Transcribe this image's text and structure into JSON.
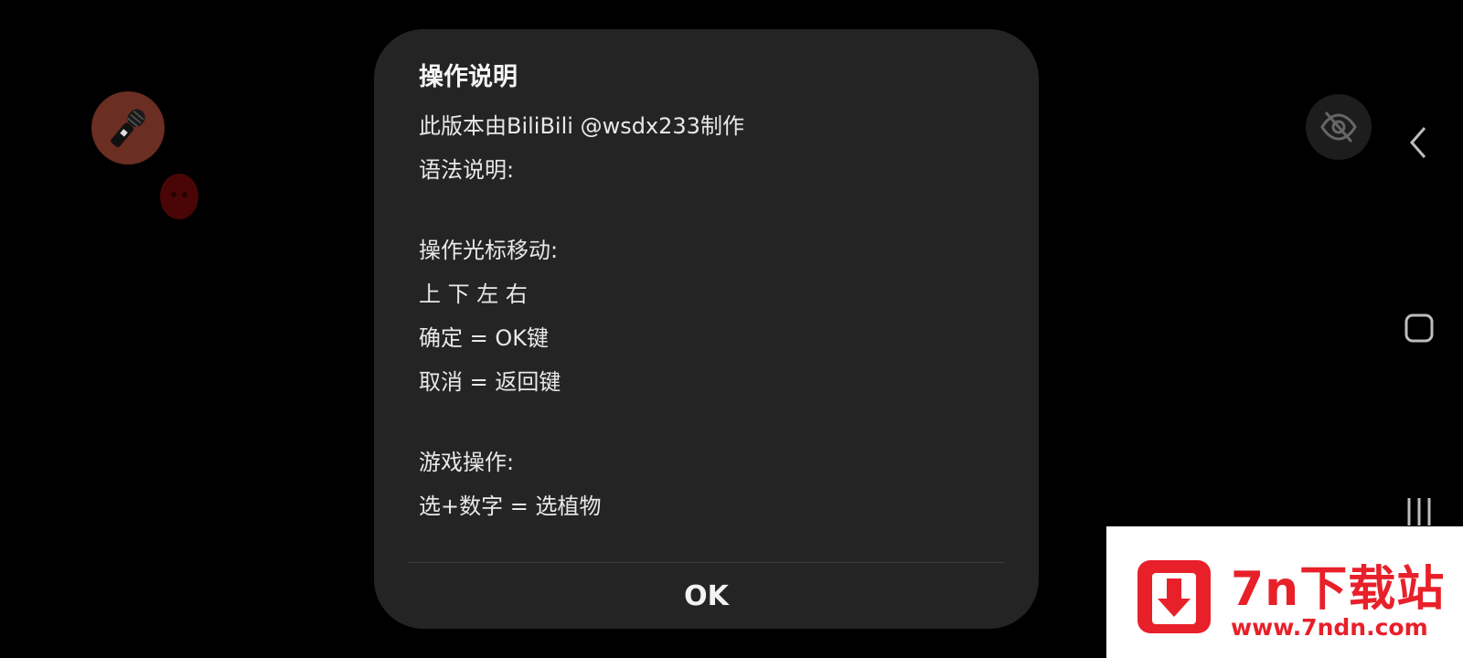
{
  "dialog": {
    "title": "操作说明",
    "lines": [
      "此版本由BiliBili @wsdx233制作",
      "语法说明:",
      "",
      "操作光标移动:",
      "上 下 左 右",
      "确定 = OK键",
      "取消 = 返回键",
      "",
      "游戏操作:",
      "选+数字 = 选植物"
    ],
    "ok_label": "OK"
  },
  "overlay": {
    "mic_icon": "microphone-icon",
    "visibility_icon": "eye-off-icon"
  },
  "nav": {
    "back_icon": "back-icon",
    "home_icon": "home-icon",
    "recents_icon": "recents-icon"
  },
  "watermark": {
    "title": "7n下载站",
    "url": "www.7ndn.com",
    "color": "#e8202a"
  }
}
